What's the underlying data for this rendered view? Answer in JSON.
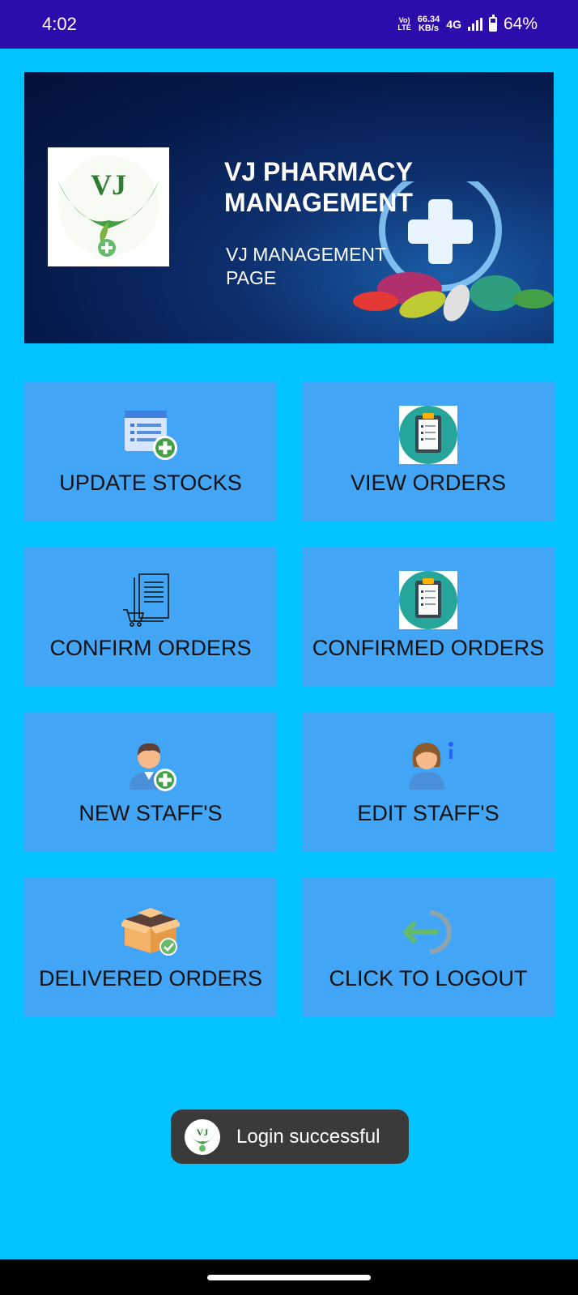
{
  "status_bar": {
    "time": "4:02",
    "volte": [
      "Vo)",
      "LTE"
    ],
    "speed": [
      "66.34",
      "KB/s"
    ],
    "network": "4G",
    "battery": "64%",
    "battery_level": 0.64
  },
  "banner": {
    "title": "VJ PHARMACY MANAGEMENT",
    "subtitle": "VJ MANAGEMENT PAGE",
    "logo_text": "VJ"
  },
  "tiles": [
    {
      "label": "UPDATE STOCKS",
      "icon": "list-add-icon"
    },
    {
      "label": "VIEW ORDERS",
      "icon": "clipboard-icon"
    },
    {
      "label": "CONFIRM ORDERS",
      "icon": "invoice-cart-icon"
    },
    {
      "label": "CONFIRMED ORDERS",
      "icon": "clipboard-icon"
    },
    {
      "label": "NEW STAFF'S",
      "icon": "add-user-icon"
    },
    {
      "label": "EDIT STAFF'S",
      "icon": "user-info-icon"
    },
    {
      "label": "DELIVERED ORDERS",
      "icon": "box-check-icon"
    },
    {
      "label": "CLICK TO LOGOUT",
      "icon": "logout-icon"
    }
  ],
  "toast": {
    "message": "Login successful",
    "logo_text": "VJ"
  },
  "colors": {
    "background": "#00C3FF",
    "status_bar": "#2C0CAB",
    "tile": "#42A5F5",
    "toast": "#3A3A3A"
  }
}
